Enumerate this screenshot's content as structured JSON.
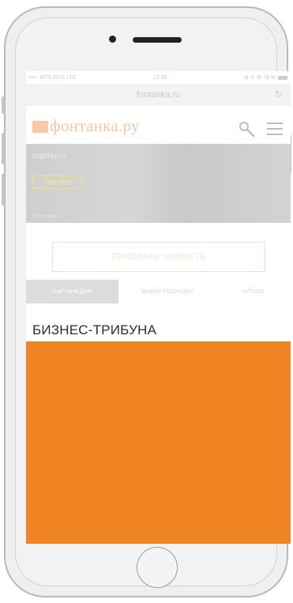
{
  "status_bar": {
    "carrier": "•••○ MTS RUS  LTE",
    "time": "12:39",
    "battery": "⊕ ✈ ⚙ 78 %"
  },
  "browser": {
    "url": "fontanka.ru",
    "reload_icon": "reload-icon"
  },
  "site": {
    "logo_text": "фонтанка.ру",
    "search_icon": "search-icon",
    "menu_icon": "hamburger-menu-icon"
  },
  "ad": {
    "domain": "supday.ru",
    "button_label": "Перейти",
    "caption": "Яндекс.Директ"
  },
  "send_news_label": "ПРИСЛАТЬ НОВОСТЬ",
  "tabs": [
    {
      "label": "КАРТИНА ДНЯ",
      "active": true
    },
    {
      "label": "ВЫБОР РЕДАКЦИИ",
      "active": false
    },
    {
      "label": "ЧИТАЮТ",
      "active": false
    }
  ],
  "section": {
    "title": "БИЗНЕС-ТРИБУНА"
  },
  "colors": {
    "accent": "#f28523",
    "phone_frame": "#b9b9b9"
  }
}
